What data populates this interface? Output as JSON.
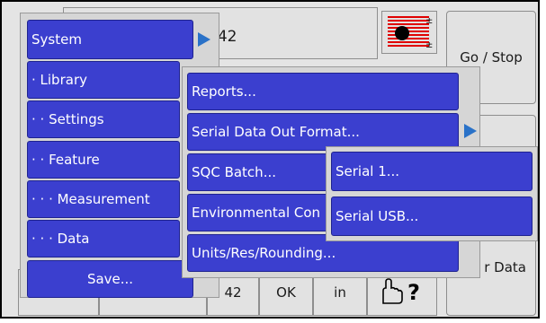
{
  "header": {
    "number_fragment": "042"
  },
  "main_menu": {
    "items": [
      {
        "label": "System"
      },
      {
        "label": "· Library"
      },
      {
        "label": "· · Settings"
      },
      {
        "label": "· · Feature"
      },
      {
        "label": "· · · Measurement"
      },
      {
        "label": "· · · Data"
      },
      {
        "label": "Save..."
      }
    ]
  },
  "sub_menu": {
    "items": [
      {
        "label": "Reports..."
      },
      {
        "label": "Serial Data Out Format..."
      },
      {
        "label": "SQC Batch..."
      },
      {
        "label": "Environmental Con"
      },
      {
        "label": "Units/Res/Rounding..."
      }
    ]
  },
  "serial_menu": {
    "items": [
      {
        "label": "Serial 1..."
      },
      {
        "label": "Serial USB..."
      }
    ]
  },
  "side_buttons": {
    "go_stop": "Go / Stop",
    "clear_data": "r Data"
  },
  "bottom_bar": {
    "value": "42",
    "ok": "OK",
    "unit": "in"
  },
  "colors": {
    "menu_blue": "#3b3fcf",
    "arrow_blue": "#2a72c8",
    "indicator_red": "#e00000"
  }
}
